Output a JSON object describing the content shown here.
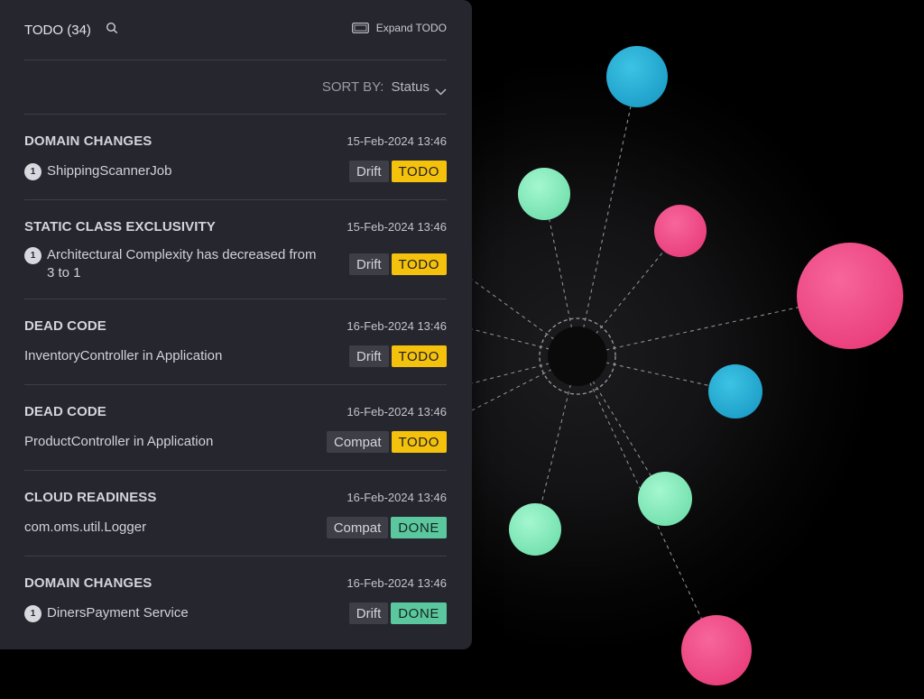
{
  "panel": {
    "title": "TODO (34)",
    "expand_label": "Expand TODO",
    "sort_label": "SORT BY:",
    "sort_value": "Status",
    "items": [
      {
        "category": "DOMAIN CHANGES",
        "date": "15-Feb-2024 13:46",
        "badge": "1",
        "description": "ShippingScannerJob",
        "type": "Drift",
        "status": "TODO"
      },
      {
        "category": "STATIC CLASS EXCLUSIVITY",
        "date": "15-Feb-2024 13:46",
        "badge": "1",
        "description": "Architectural Complexity has decreased from 3 to 1",
        "type": "Drift",
        "status": "TODO"
      },
      {
        "category": "DEAD CODE",
        "date": "16-Feb-2024 13:46",
        "badge": "",
        "description": "InventoryController in Application",
        "type": "Drift",
        "status": "TODO"
      },
      {
        "category": "DEAD CODE",
        "date": "16-Feb-2024 13:46",
        "badge": "",
        "description": "ProductController in Application",
        "type": "Compat",
        "status": "TODO"
      },
      {
        "category": "CLOUD READINESS",
        "date": "16-Feb-2024 13:46",
        "badge": "",
        "description": "com.oms.util.Logger",
        "type": "Compat",
        "status": "DONE"
      },
      {
        "category": "DOMAIN CHANGES",
        "date": "16-Feb-2024 13:46",
        "badge": "1",
        "description": "DinersPayment Service",
        "type": "Drift",
        "status": "DONE"
      }
    ]
  },
  "icons": {
    "search": "search-icon",
    "expand": "expand-icon",
    "chevron": "chevron-down-icon"
  },
  "colors": {
    "panel_bg": "#25262e",
    "todo": "#f4c20d",
    "done": "#5bc79e",
    "node_blue": "#2ab3d8",
    "node_green": "#8ef0c0",
    "node_pink": "#f0508c"
  }
}
